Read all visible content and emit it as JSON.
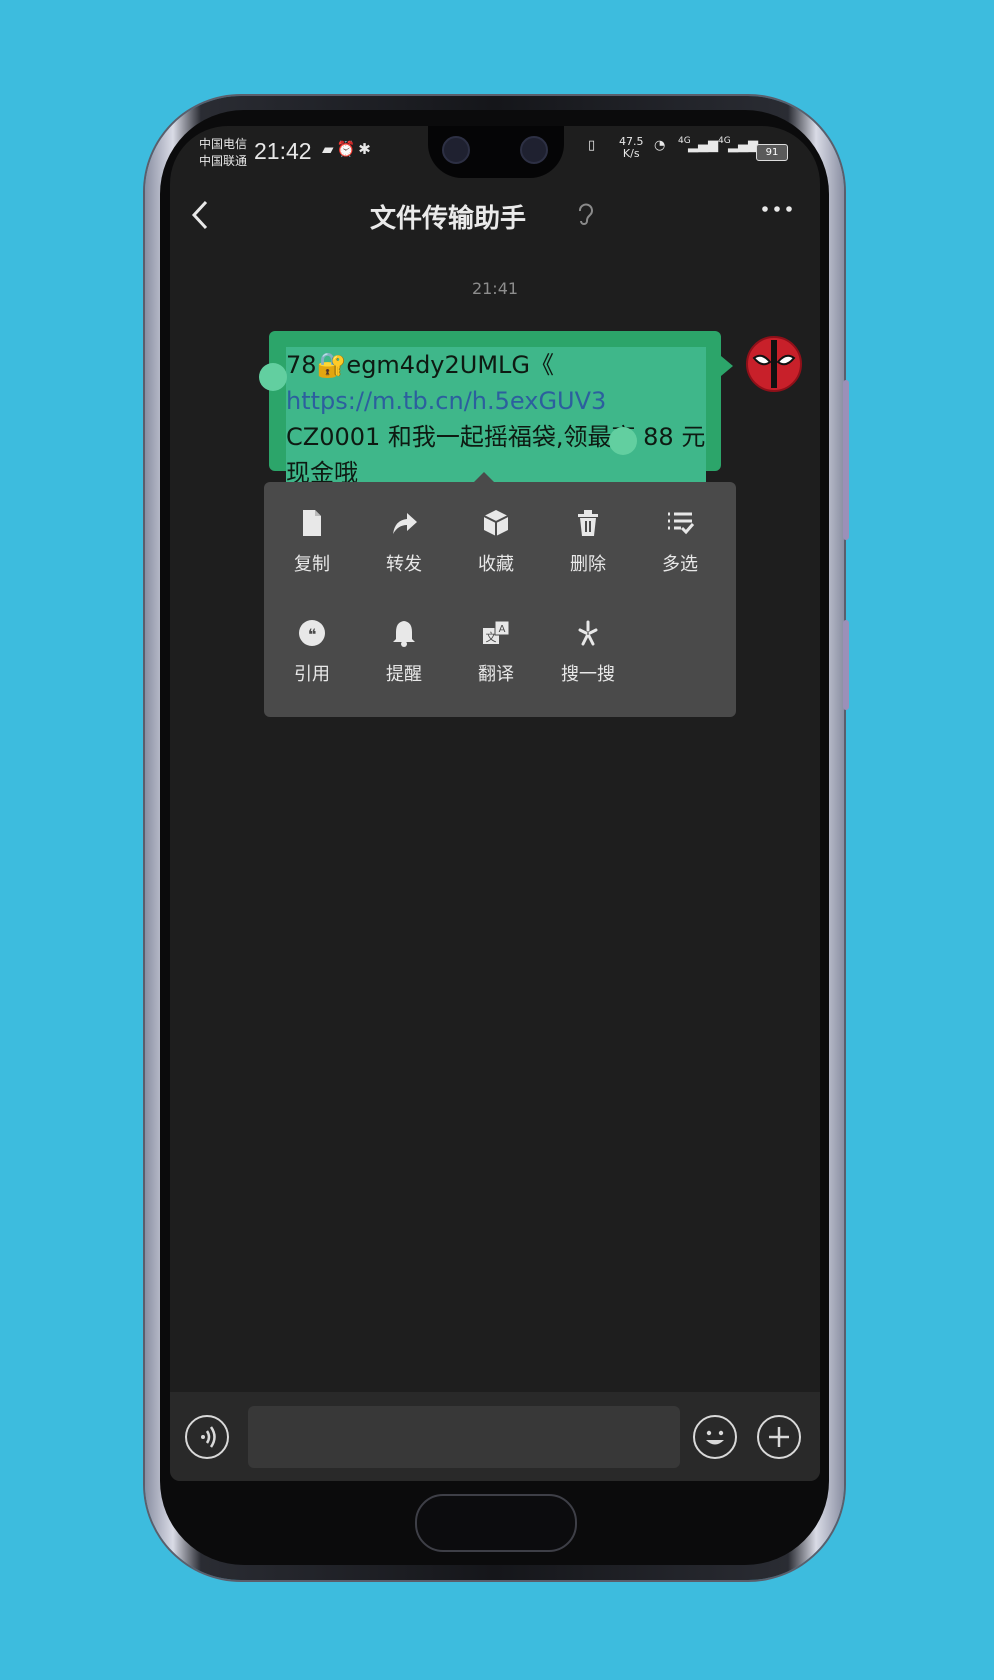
{
  "status_bar": {
    "carrier_1": "中国电信",
    "carrier_2": "中国联通",
    "time": "21:42",
    "net_speed_value": "47.5",
    "net_speed_unit": "K/s",
    "signal_1": "4G",
    "signal_2": "4G",
    "battery": "91"
  },
  "header": {
    "title": "文件传输助手",
    "back_icon": "chevron-left-icon",
    "more_icon": "more-dots-icon"
  },
  "chat": {
    "timestamp": "21:41",
    "message": {
      "part1": "78🔐egm4dy2UMLG《 ",
      "link": "https://m.tb.cn/h.5exGUV3",
      "part2": " CZ0001 和我一起摇福袋,领最高 88 元现金哦"
    }
  },
  "context_menu": {
    "row1": [
      {
        "label": "复制",
        "icon": "document-icon"
      },
      {
        "label": "转发",
        "icon": "forward-icon"
      },
      {
        "label": "收藏",
        "icon": "cube-icon"
      },
      {
        "label": "删除",
        "icon": "trash-icon"
      },
      {
        "label": "多选",
        "icon": "multi-select-icon"
      }
    ],
    "row2": [
      {
        "label": "引用",
        "icon": "quote-icon"
      },
      {
        "label": "提醒",
        "icon": "bell-icon"
      },
      {
        "label": "翻译",
        "icon": "translate-icon"
      },
      {
        "label": "搜一搜",
        "icon": "search-sparkle-icon"
      }
    ]
  },
  "input_bar": {
    "voice_icon": "voice-icon",
    "emoji_icon": "emoji-icon",
    "plus_icon": "plus-icon",
    "text_value": ""
  },
  "colors": {
    "background": "#3dbcde",
    "bubble": "#2ca56a",
    "link": "#2c5f9e",
    "menu": "#4a4a4a"
  }
}
